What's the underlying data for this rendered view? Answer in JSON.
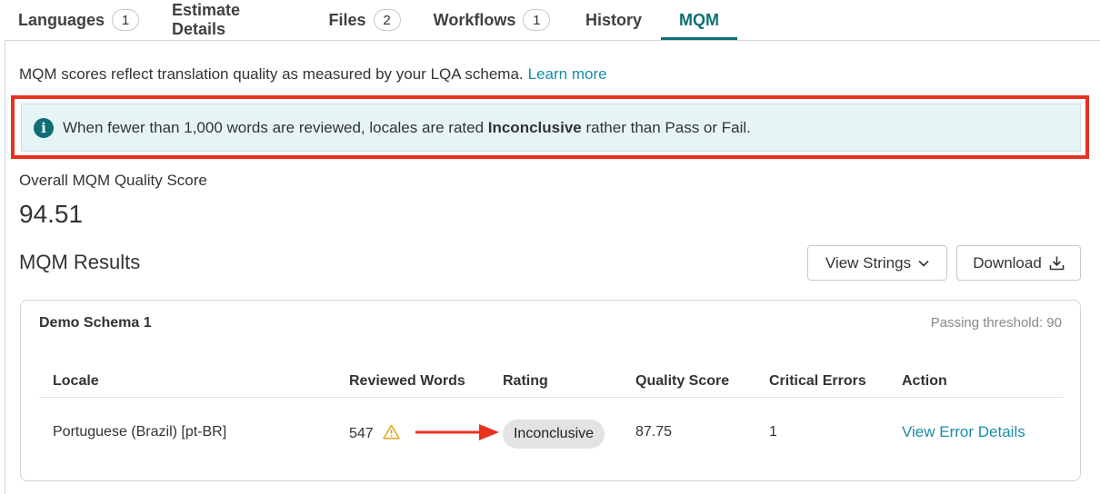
{
  "tabs": [
    {
      "label": "Languages",
      "count": "1"
    },
    {
      "label": "Estimate Details"
    },
    {
      "label": "Files",
      "count": "2"
    },
    {
      "label": "Workflows",
      "count": "1"
    },
    {
      "label": "History"
    },
    {
      "label": "MQM",
      "active": true
    }
  ],
  "intro": {
    "text": "MQM scores reflect translation quality as measured by your LQA schema.",
    "link": "Learn more"
  },
  "banner": {
    "icon": "info-icon",
    "text_before": "When fewer than 1,000 words are reviewed, locales are rated ",
    "text_bold": "Inconclusive",
    "text_after": " rather than Pass or Fail."
  },
  "overall": {
    "label": "Overall MQM Quality Score",
    "value": "94.51"
  },
  "results": {
    "title": "MQM Results",
    "view_strings_label": "View Strings",
    "download_label": "Download"
  },
  "schema": {
    "name": "Demo Schema 1",
    "threshold": "Passing threshold: 90",
    "columns": [
      "Locale",
      "Reviewed Words",
      "Rating",
      "Quality Score",
      "Critical Errors",
      "Action"
    ],
    "rows": [
      {
        "locale": "Portuguese (Brazil) [pt-BR]",
        "reviewed_words": "547",
        "rating": "Inconclusive",
        "quality_score": "87.75",
        "critical_errors": "1",
        "action": "View Error Details"
      }
    ]
  },
  "colors": {
    "accent": "#0d6f74",
    "link": "#1a8ca8",
    "annotation": "#e8321f",
    "banner_bg": "#e6f4f5",
    "warning": "#e8a020"
  }
}
